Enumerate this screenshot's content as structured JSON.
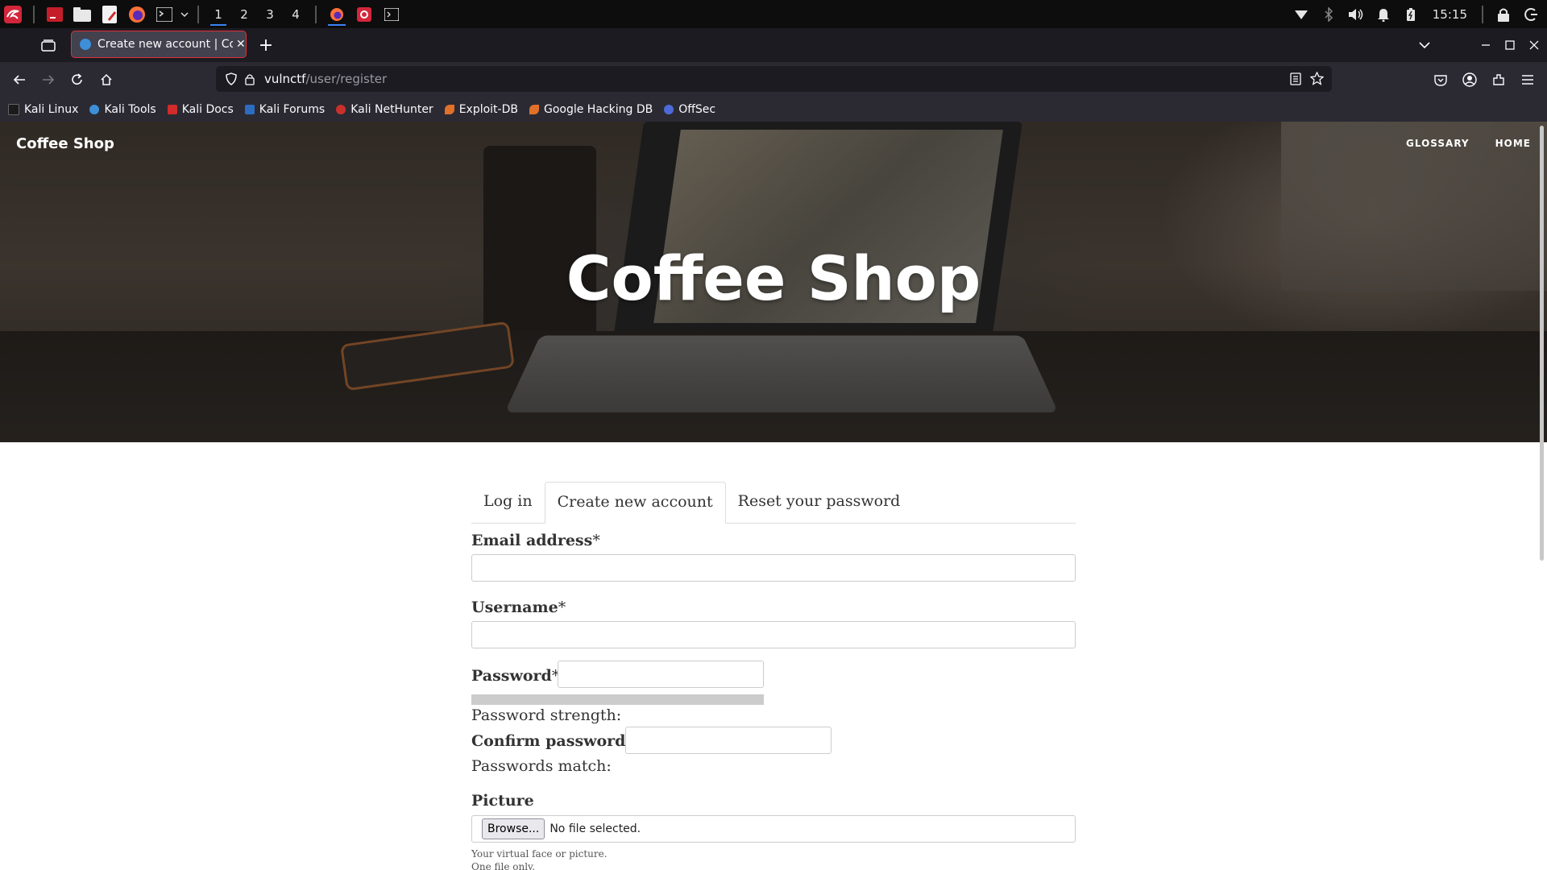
{
  "system_panel": {
    "workspaces": [
      "1",
      "2",
      "3",
      "4"
    ],
    "clock": "15:15"
  },
  "browser": {
    "tab_title": "Create new account | Coffee Shop",
    "url_host": "vulnctf",
    "url_path": "/user/register",
    "bookmarks": [
      {
        "label": "Kali Linux",
        "color": "#1b1b1b"
      },
      {
        "label": "Kali Tools",
        "color": "#3d8fd8"
      },
      {
        "label": "Kali Docs",
        "color": "#d12b2b"
      },
      {
        "label": "Kali Forums",
        "color": "#2d6cc0"
      },
      {
        "label": "Kali NetHunter",
        "color": "#c9302c"
      },
      {
        "label": "Exploit-DB",
        "color": "#e0702a"
      },
      {
        "label": "Google Hacking DB",
        "color": "#e0702a"
      },
      {
        "label": "OffSec",
        "color": "#4d6bd8"
      }
    ]
  },
  "site": {
    "brand": "Coffee Shop",
    "nav": [
      "GLOSSARY",
      "HOME"
    ],
    "hero_title": "Coffee Shop"
  },
  "form": {
    "tabs": [
      "Log in",
      "Create new account",
      "Reset your password"
    ],
    "email_label": "Email address",
    "username_label": "Username",
    "password_label": "Password",
    "required_mark": "*",
    "password_strength": "Password strength:",
    "confirm_label": "Confirm password",
    "passwords_match": "Passwords match:",
    "picture_label": "Picture",
    "browse_label": "Browse...",
    "no_file": "No file selected.",
    "help_1": "Your virtual face or picture.",
    "help_2": "One file only."
  }
}
